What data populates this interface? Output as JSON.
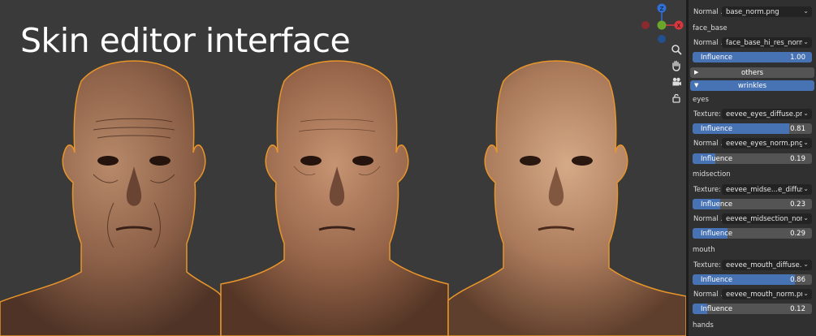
{
  "viewport": {
    "title": "Skin editor interface",
    "gizmo": {
      "z_label": "Z",
      "x_label": "X"
    },
    "tools": [
      "zoom-icon",
      "hand-icon",
      "camera-icon",
      "lock-icon"
    ]
  },
  "panel": {
    "rows": [
      {
        "kind": "field",
        "label": "Normal ...",
        "value": "base_norm.png"
      },
      {
        "kind": "section",
        "label": "face_base"
      },
      {
        "kind": "field",
        "label": "Normal ...",
        "value": "face_base_hi_res_norm.png"
      },
      {
        "kind": "slider",
        "label": "Influence",
        "value": "1.00",
        "fraction": 1.0
      },
      {
        "kind": "header",
        "label": "others",
        "expanded": false,
        "color": "#545454"
      },
      {
        "kind": "header",
        "label": "wrinkles",
        "expanded": true,
        "color": "#4772b3"
      },
      {
        "kind": "section",
        "label": "eyes"
      },
      {
        "kind": "field",
        "label": "Texture:",
        "value": "eevee_eyes_diffuse.png"
      },
      {
        "kind": "slider",
        "label": "Influence",
        "value": "0.81",
        "fraction": 0.81
      },
      {
        "kind": "field",
        "label": "Normal ...",
        "value": "eevee_eyes_norm.png"
      },
      {
        "kind": "slider",
        "label": "Influence",
        "value": "0.19",
        "fraction": 0.19
      },
      {
        "kind": "section",
        "label": "midsection"
      },
      {
        "kind": "field",
        "label": "Texture:",
        "value": "eevee_midse...e_diffuse.png"
      },
      {
        "kind": "slider",
        "label": "Influence",
        "value": "0.23",
        "fraction": 0.23
      },
      {
        "kind": "field",
        "label": "Normal ...",
        "value": "eevee_midsection_norm.png"
      },
      {
        "kind": "slider",
        "label": "Influence",
        "value": "0.29",
        "fraction": 0.29
      },
      {
        "kind": "section",
        "label": "mouth"
      },
      {
        "kind": "field",
        "label": "Texture:",
        "value": "eevee_mouth_diffuse.png"
      },
      {
        "kind": "slider",
        "label": "Influence",
        "value": "0.86",
        "fraction": 0.86
      },
      {
        "kind": "field",
        "label": "Normal ...",
        "value": "eevee_mouth_norm.png"
      },
      {
        "kind": "slider",
        "label": "Influence",
        "value": "0.12",
        "fraction": 0.12
      },
      {
        "kind": "section",
        "label": "hands"
      }
    ]
  },
  "colors": {
    "accent": "#4772b3",
    "outline": "#e8952a",
    "gizmo_x": "#d8383d",
    "gizmo_y": "#6aa62a",
    "gizmo_z": "#2f6fd6"
  }
}
